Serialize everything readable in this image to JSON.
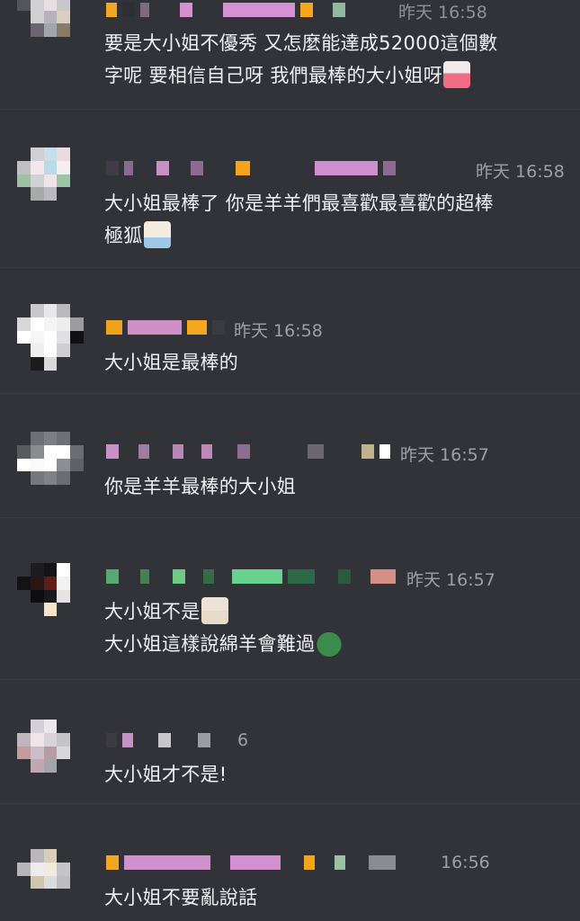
{
  "messages": [
    {
      "timestamp": "昨天 16:58",
      "lines": [
        "要是大小姐不優秀 又怎麼能達成52000這個數",
        "字呢 要相信自己呀 我們最棒的大小姐呀"
      ],
      "sticker": "heart-girl-sticker"
    },
    {
      "timestamp": "昨天 16:58",
      "lines": [
        "大小姐最棒了 你是羊羊們最喜歡最喜歡的超棒",
        "極狐"
      ],
      "sticker": "crying-girl-sticker"
    },
    {
      "timestamp": "昨天 16:58",
      "lines": [
        "大小姐是最棒的"
      ]
    },
    {
      "timestamp": "昨天 16:57",
      "lines": [
        "你是羊羊最棒的大小姐"
      ]
    },
    {
      "timestamp": "昨天 16:57",
      "lines": [
        "大小姐不是",
        "大小姐這樣說綿羊會難過"
      ],
      "stickers": [
        "shy-girl-sticker",
        "frog-sticker"
      ]
    },
    {
      "timestamp": "6",
      "lines": [
        "大小姐才不是!"
      ]
    },
    {
      "timestamp": "16:56",
      "lines": [
        "大小姐不要亂說話"
      ]
    }
  ]
}
